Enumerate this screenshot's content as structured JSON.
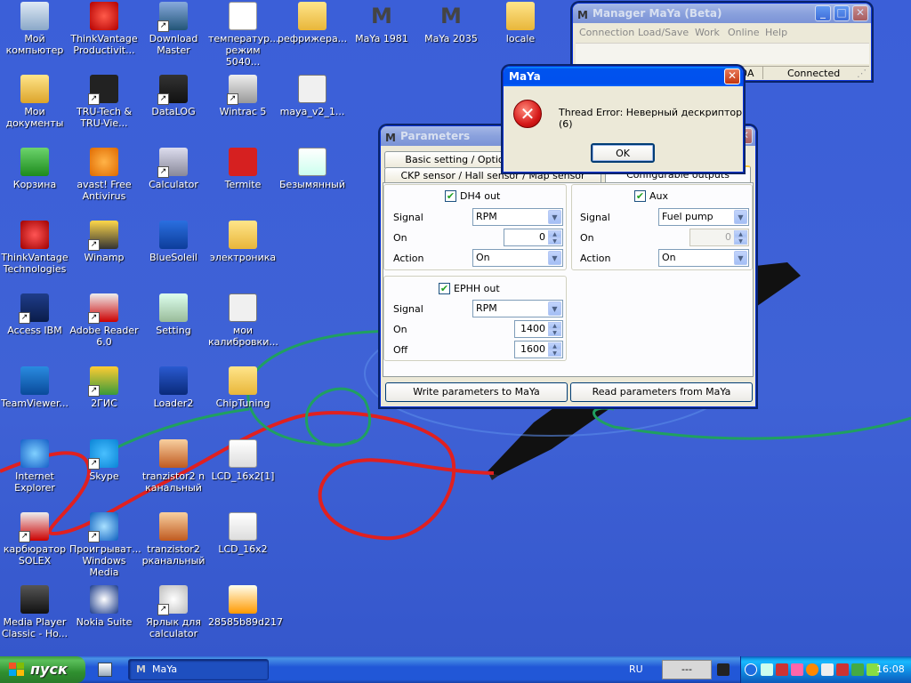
{
  "desktop": {
    "icons": [
      {
        "label": "Мой компьютер"
      },
      {
        "label": "ThinkVantage Productivit..."
      },
      {
        "label": "Download Master"
      },
      {
        "label": "температур... режим 5040..."
      },
      {
        "label": "рефрижера..."
      },
      {
        "label": "MaYa 1981"
      },
      {
        "label": "MaYa 2035"
      },
      {
        "label": "locale"
      },
      {
        "label": "Мои документы"
      },
      {
        "label": "TRU-Tech & TRU-Vie..."
      },
      {
        "label": "DataLOG"
      },
      {
        "label": "Wintrac 5"
      },
      {
        "label": "maya_v2_1..."
      },
      {
        "label": "Корзина"
      },
      {
        "label": "avast! Free Antivirus"
      },
      {
        "label": "Calculator"
      },
      {
        "label": "Termite"
      },
      {
        "label": "Безымянный"
      },
      {
        "label": "ThinkVantage Technologies"
      },
      {
        "label": "Winamp"
      },
      {
        "label": "BlueSoleil"
      },
      {
        "label": "электроника"
      },
      {
        "label": "Access IBM"
      },
      {
        "label": "Adobe Reader 6.0"
      },
      {
        "label": "Setting"
      },
      {
        "label": "мои калибровки..."
      },
      {
        "label": "TeamViewer..."
      },
      {
        "label": "2ГИС"
      },
      {
        "label": "Loader2"
      },
      {
        "label": "ChipTuning"
      },
      {
        "label": "Internet Explorer"
      },
      {
        "label": "Skype"
      },
      {
        "label": "tranzistor2 n канальный"
      },
      {
        "label": "LCD_16x2[1]"
      },
      {
        "label": "карбюратор SOLEX"
      },
      {
        "label": "Проигрыват... Windows Media"
      },
      {
        "label": "tranzistor2 рканальный"
      },
      {
        "label": "LCD_16x2"
      },
      {
        "label": "Media Player Classic - Ho..."
      },
      {
        "label": "Nokia Suite"
      },
      {
        "label": "Ярлык для calculator"
      },
      {
        "label": "28585b89d217"
      }
    ]
  },
  "manager": {
    "title": "Manager MaYa (Beta)",
    "menu": [
      "Connection",
      "Load/Save",
      "Work",
      "Online",
      "Help"
    ],
    "status_left": "0A",
    "status_right": "Connected"
  },
  "params": {
    "title": "Parameters",
    "tabs": [
      "Basic setting / Option",
      "CKP sensor / Hall sensor / Map sensor",
      "Configurable outputs"
    ],
    "dh4": {
      "title": "DH4 out",
      "signal_label": "Signal",
      "signal_value": "RPM",
      "on_label": "On",
      "on_value": "0",
      "action_label": "Action",
      "action_value": "On"
    },
    "aux": {
      "title": "Aux",
      "signal_label": "Signal",
      "signal_value": "Fuel pump",
      "on_label": "On",
      "on_value": "0",
      "action_label": "Action",
      "action_value": "On"
    },
    "ephh": {
      "title": "EPHH out",
      "signal_label": "Signal",
      "signal_value": "RPM",
      "on_label": "On",
      "on_value": "1400",
      "off_label": "Off",
      "off_value": "1600"
    },
    "write_button": "Write parameters to MaYa",
    "read_button": "Read parameters from MaYa"
  },
  "error_dialog": {
    "title": "MaYa",
    "message": "Thread Error: Неверный дескриптор (6)",
    "ok": "OK"
  },
  "taskbar": {
    "start": "пуск",
    "task_label": "MaYa",
    "language": "RU",
    "status_box": "---",
    "clock": "16:08"
  },
  "colors": {
    "desktop": "#3b5fd8",
    "title_active": "#0053ee",
    "error_red": "#d61a1a",
    "checkbox_green": "#21a121"
  }
}
